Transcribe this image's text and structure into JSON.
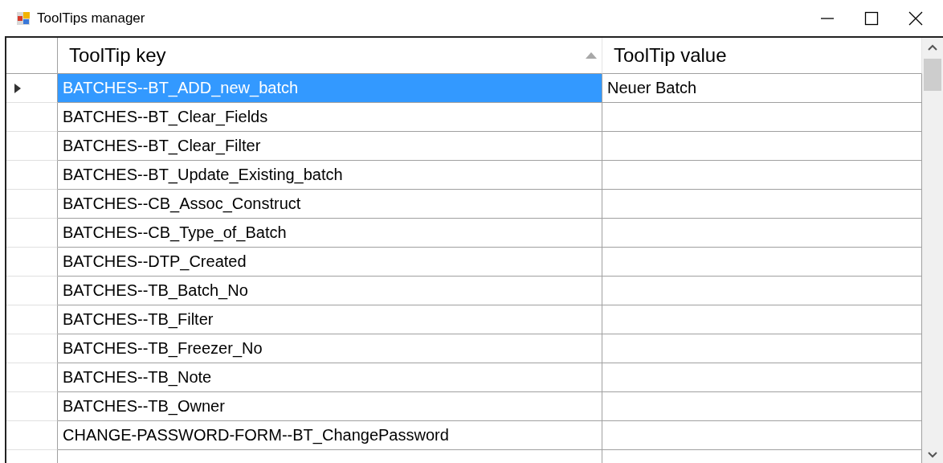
{
  "window": {
    "title": "ToolTips manager"
  },
  "columns": [
    {
      "label": "ToolTip key",
      "sorted_ascending": true
    },
    {
      "label": "ToolTip value",
      "sorted_ascending": false
    }
  ],
  "rows": [
    {
      "key": "BATCHES--BT_ADD_new_batch",
      "value": "Neuer Batch",
      "selected": true
    },
    {
      "key": "BATCHES--BT_Clear_Fields",
      "value": "",
      "selected": false
    },
    {
      "key": "BATCHES--BT_Clear_Filter",
      "value": "",
      "selected": false
    },
    {
      "key": "BATCHES--BT_Update_Existing_batch",
      "value": "",
      "selected": false
    },
    {
      "key": "BATCHES--CB_Assoc_Construct",
      "value": "",
      "selected": false
    },
    {
      "key": "BATCHES--CB_Type_of_Batch",
      "value": "",
      "selected": false
    },
    {
      "key": "BATCHES--DTP_Created",
      "value": "",
      "selected": false
    },
    {
      "key": "BATCHES--TB_Batch_No",
      "value": "",
      "selected": false
    },
    {
      "key": "BATCHES--TB_Filter",
      "value": "",
      "selected": false
    },
    {
      "key": "BATCHES--TB_Freezer_No",
      "value": "",
      "selected": false
    },
    {
      "key": "BATCHES--TB_Note",
      "value": "",
      "selected": false
    },
    {
      "key": "BATCHES--TB_Owner",
      "value": "",
      "selected": false
    },
    {
      "key": "CHANGE-PASSWORD-FORM--BT_ChangePassword",
      "value": "",
      "selected": false
    }
  ]
}
